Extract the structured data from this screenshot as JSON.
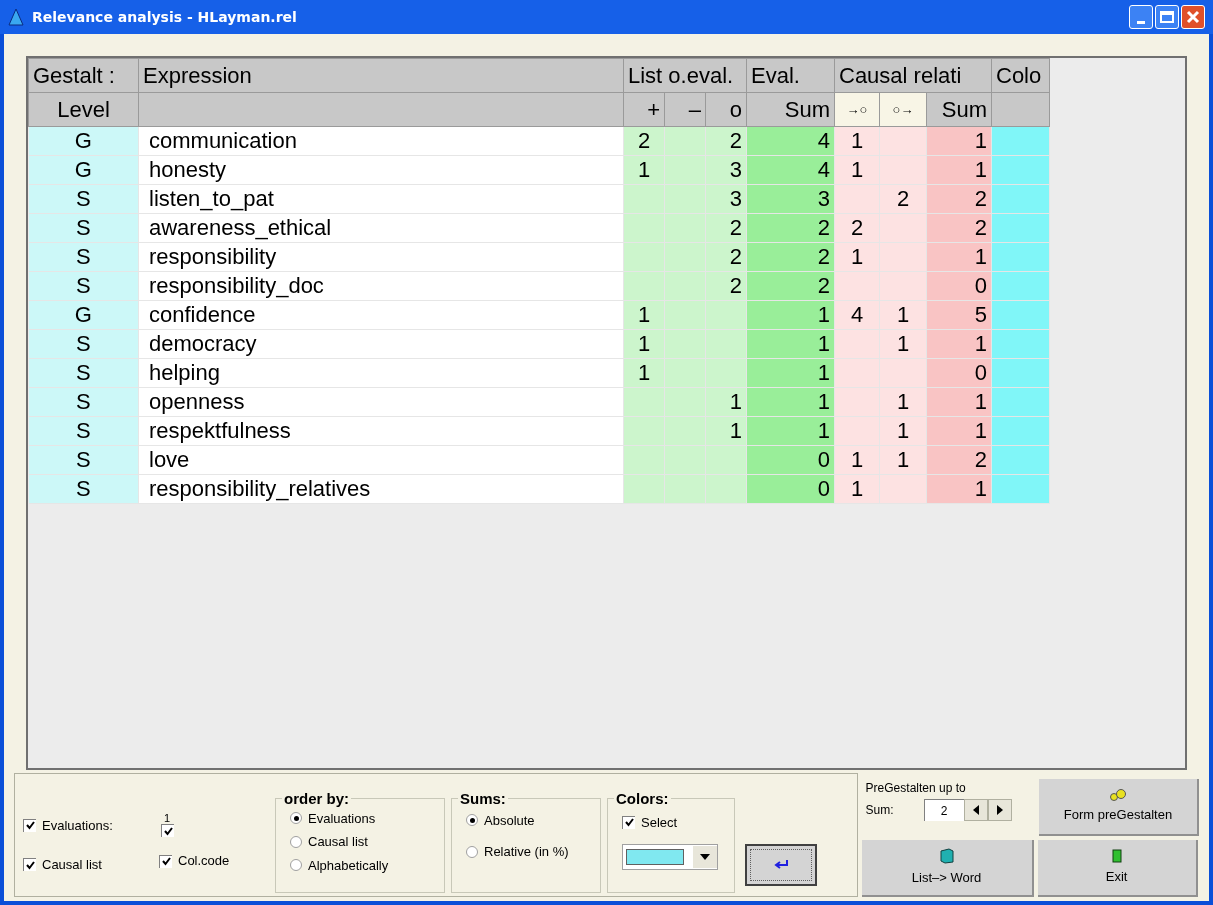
{
  "window": {
    "title": "Relevance analysis - HLayman.rel"
  },
  "header_top": [
    "Gestalt :",
    "Expression",
    "List o.eval.",
    "Eval.",
    "Causal relati",
    "Colo"
  ],
  "header_sub": {
    "level": "Level",
    "plus": "+",
    "minus": "–",
    "o": "o",
    "sum": "Sum",
    "cause_in": "→○",
    "cause_out": "○→",
    "causal_sum": "Sum"
  },
  "rows": [
    {
      "level": "G",
      "expression": "communication",
      "plus": "2",
      "o": "2",
      "sum": "4",
      "cause_in": "1",
      "causal_sum": "1"
    },
    {
      "level": "G",
      "expression": "honesty",
      "plus": "1",
      "o": "3",
      "sum": "4",
      "cause_in": "1",
      "causal_sum": "1"
    },
    {
      "level": "S",
      "expression": "listen_to_pat",
      "o": "3",
      "sum": "3",
      "cause_out": "2",
      "causal_sum": "2"
    },
    {
      "level": "S",
      "expression": "awareness_ethical",
      "o": "2",
      "sum": "2",
      "cause_in": "2",
      "causal_sum": "2"
    },
    {
      "level": "S",
      "expression": "responsibility",
      "o": "2",
      "sum": "2",
      "cause_in": "1",
      "causal_sum": "1"
    },
    {
      "level": "S",
      "expression": "responsibility_doc",
      "o": "2",
      "sum": "2",
      "causal_sum": "0"
    },
    {
      "level": "G",
      "expression": "confidence",
      "plus": "1",
      "sum": "1",
      "cause_in": "4",
      "cause_out": "1",
      "causal_sum": "5"
    },
    {
      "level": "S",
      "expression": "democracy",
      "plus": "1",
      "sum": "1",
      "cause_out": "1",
      "causal_sum": "1"
    },
    {
      "level": "S",
      "expression": "helping",
      "plus": "1",
      "sum": "1",
      "causal_sum": "0"
    },
    {
      "level": "S",
      "expression": "openness",
      "o": "1",
      "sum": "1",
      "cause_out": "1",
      "causal_sum": "1"
    },
    {
      "level": "S",
      "expression": "respektfulness",
      "o": "1",
      "sum": "1",
      "cause_out": "1",
      "causal_sum": "1"
    },
    {
      "level": "S",
      "expression": "love",
      "sum": "0",
      "cause_in": "1",
      "cause_out": "1",
      "causal_sum": "2"
    },
    {
      "level": "S",
      "expression": "responsibility_relatives",
      "sum": "0",
      "cause_in": "1",
      "causal_sum": "1"
    }
  ],
  "options": {
    "evaluations": {
      "label": "Evaluations:",
      "checked": true
    },
    "small_label": "1",
    "small_checked": true,
    "causal_list": {
      "label": "Causal list",
      "checked": true
    },
    "col_code": {
      "label": "Col.code",
      "checked": true
    }
  },
  "order_by": {
    "title": "order by:",
    "options": [
      {
        "label": "Evaluations",
        "selected": true
      },
      {
        "label": "Causal list",
        "selected": false
      },
      {
        "label": "Alphabetically",
        "selected": false
      }
    ]
  },
  "sums": {
    "title": "Sums:",
    "options": [
      {
        "label": "Absolute",
        "selected": true
      },
      {
        "label": "Relative (in %)",
        "selected": false
      }
    ]
  },
  "colors": {
    "title": "Colors:",
    "select": {
      "label": "Select",
      "checked": true
    },
    "color": "#80e8f0"
  },
  "pregestalten": {
    "label": "PreGestalten up to",
    "sum_label": "Sum:",
    "value": "2"
  },
  "buttons": {
    "form": "Form preGestalten",
    "word": "List–> Word",
    "exit": "Exit"
  }
}
